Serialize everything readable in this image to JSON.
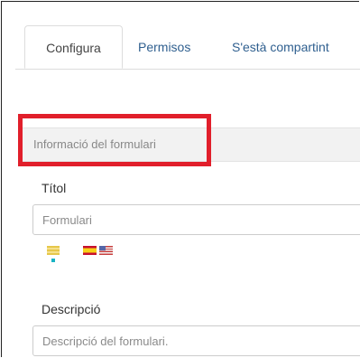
{
  "tabs": [
    {
      "label": "Configura",
      "active": true
    },
    {
      "label": "Permisos",
      "active": false
    },
    {
      "label": "S'està compartint",
      "active": false
    }
  ],
  "section": {
    "title": "Informació del formulari"
  },
  "fields": {
    "title": {
      "label": "Títol",
      "placeholder": "Formulari",
      "value": ""
    },
    "description": {
      "label": "Descripció",
      "placeholder": "Descripció del formulari.",
      "value": ""
    }
  },
  "language_flags": [
    {
      "icon": "language-default-flag-icon"
    },
    {
      "icon": "spain-flag-icon"
    },
    {
      "icon": "usa-flag-icon"
    }
  ],
  "colors": {
    "highlight": "#e11f2b",
    "link": "#2f5f8f",
    "section_bg": "#f2f2f2",
    "lang_indicator": "#19b3c4"
  }
}
